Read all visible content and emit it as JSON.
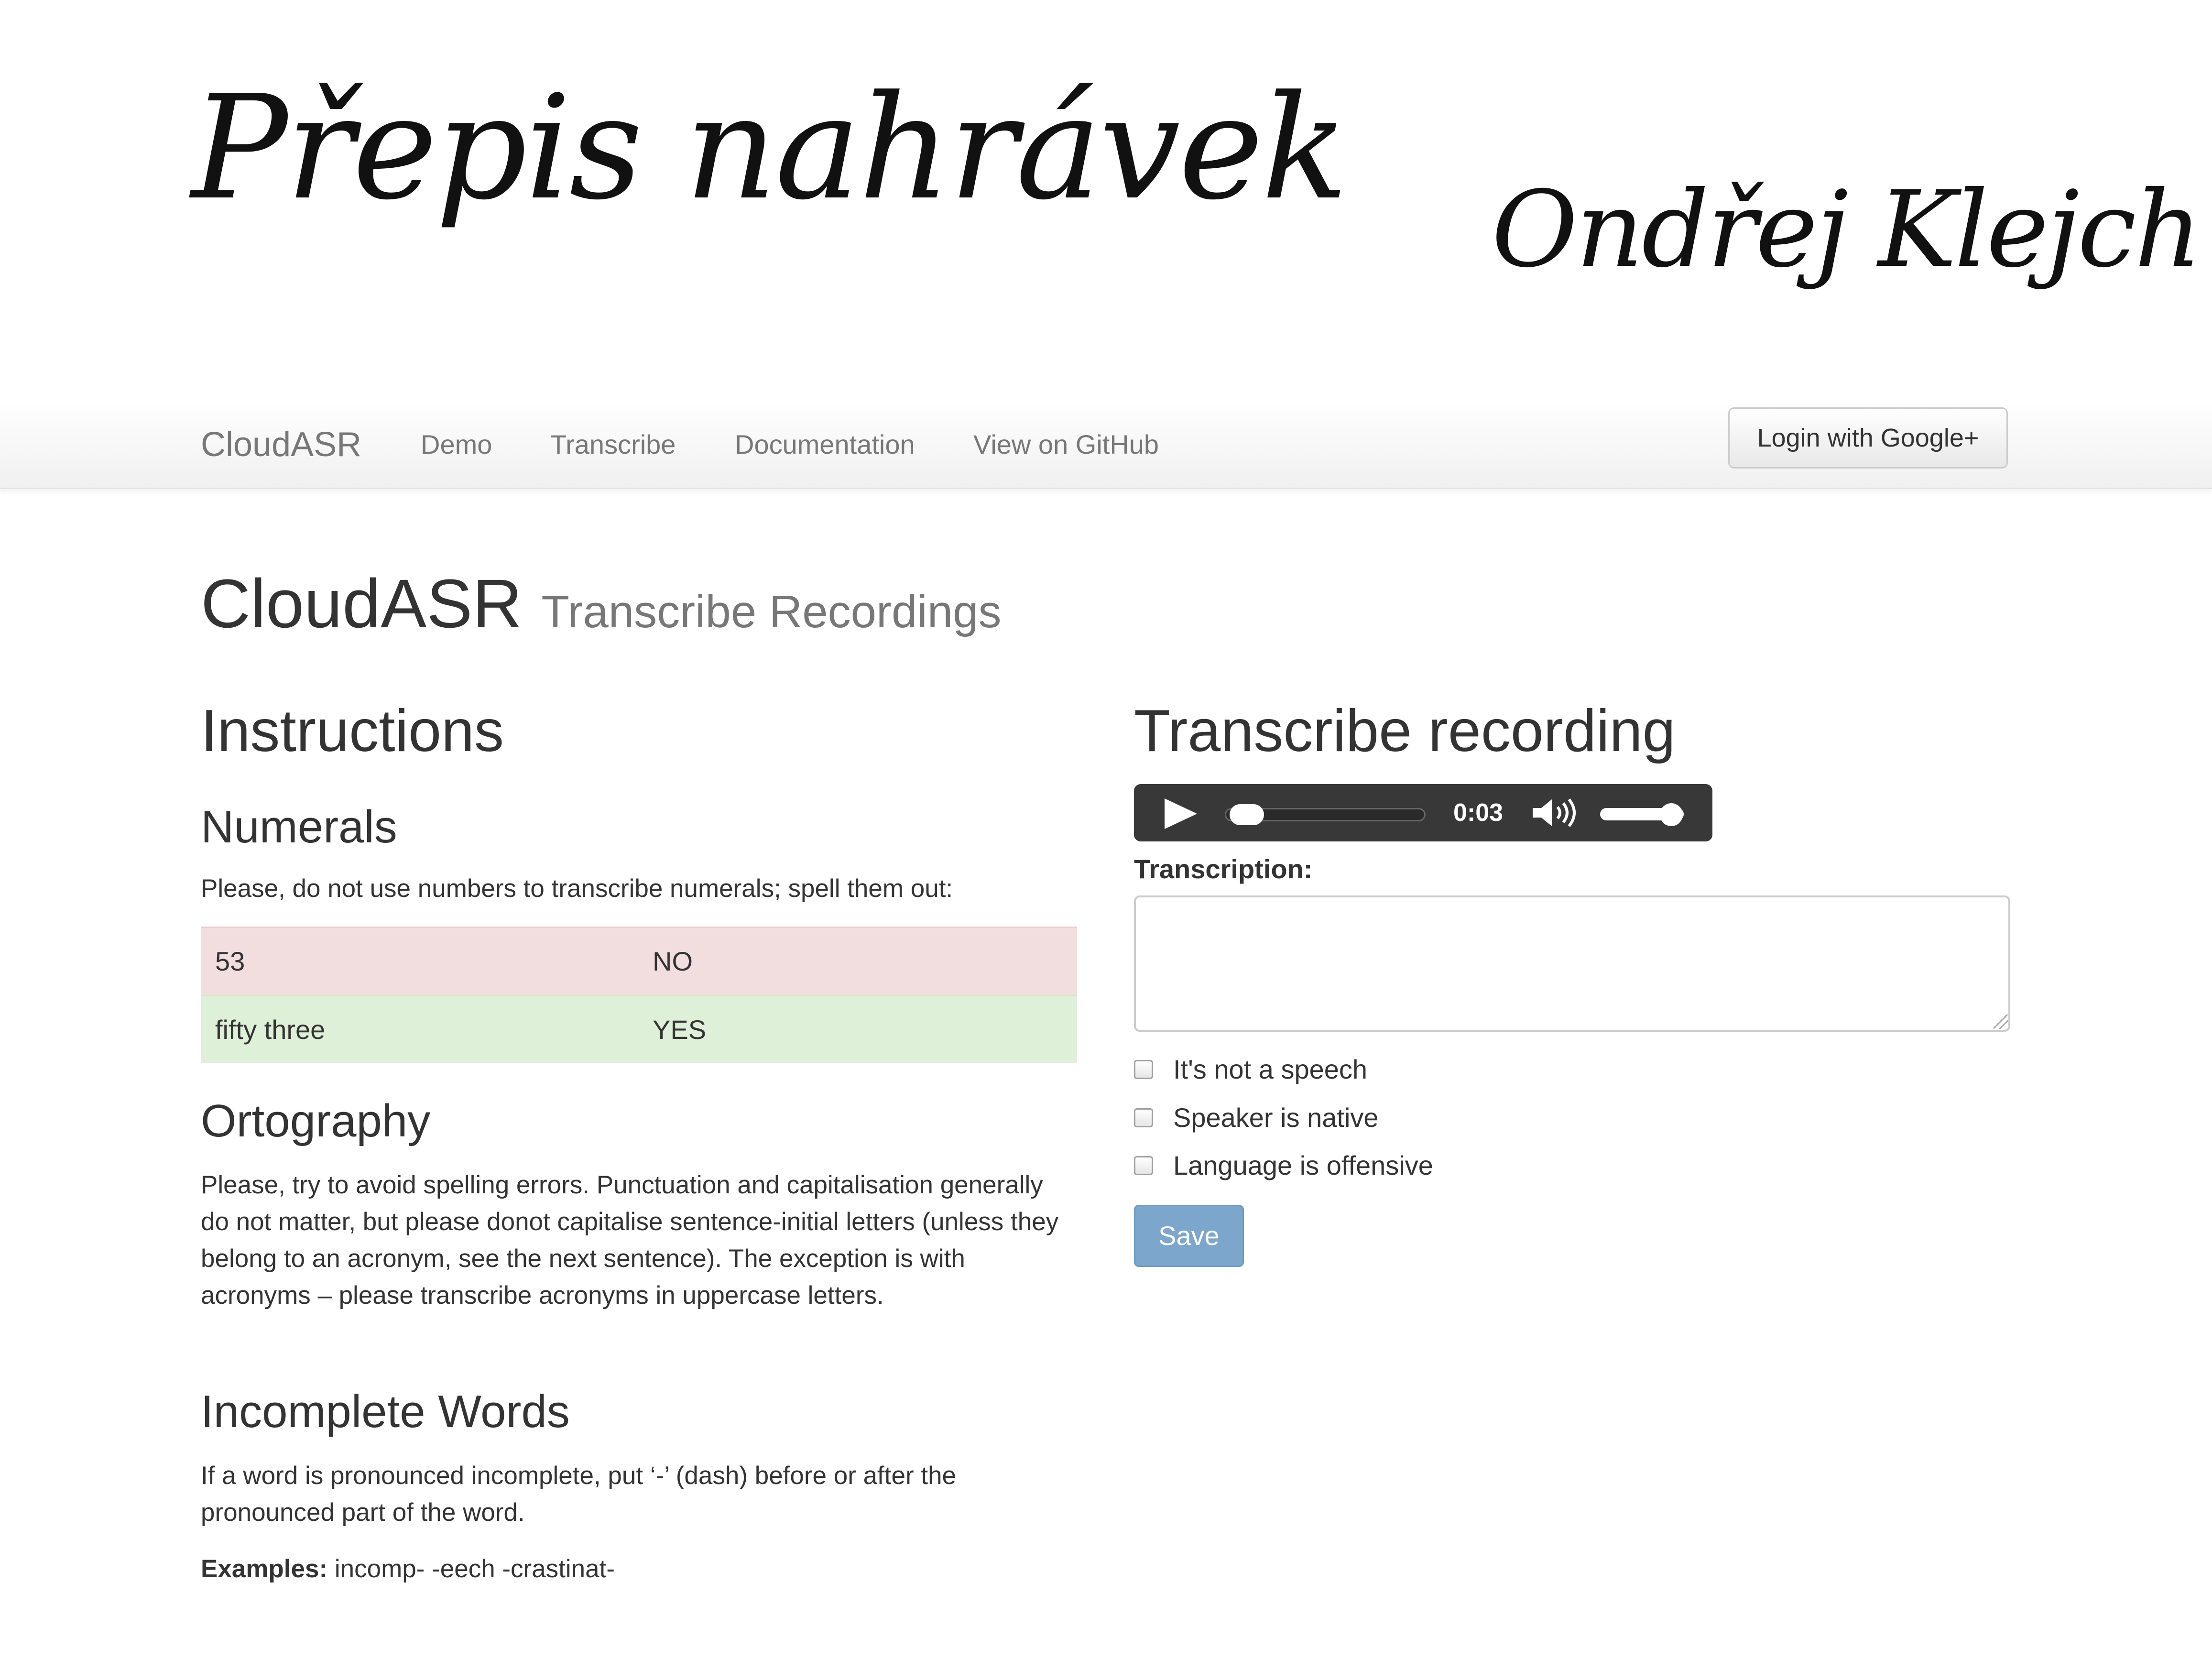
{
  "handwritten": {
    "title": "Přepis nahrávek",
    "author": "Ondřej Klejch"
  },
  "navbar": {
    "brand": "CloudASR",
    "links": [
      "Demo",
      "Transcribe",
      "Documentation",
      "View on GitHub"
    ],
    "login_label": "Login with Google+"
  },
  "header": {
    "title": "CloudASR",
    "subtitle": "Transcribe Recordings"
  },
  "instructions": {
    "heading": "Instructions",
    "numerals": {
      "heading": "Numerals",
      "text": "Please, do not use numbers to transcribe numerals; spell them out:",
      "rows": [
        {
          "example": "53",
          "verdict": "NO"
        },
        {
          "example": "fifty three",
          "verdict": "YES"
        }
      ]
    },
    "ortography": {
      "heading": "Ortography",
      "text": "Please, try to avoid spelling errors. Punctuation and capitalisation generally do not matter, but please donot capitalise sentence-initial letters (unless they belong to an acronym, see the next sentence). The exception is with acronyms – please transcribe acronyms in uppercase letters."
    },
    "incomplete": {
      "heading": "Incomplete Words",
      "text": "If a word is pronounced incomplete, put ‘-’ (dash) before or after the pronounced part of the word.",
      "examples_label": "Examples:",
      "examples": "incomp- -eech -crastinat-"
    }
  },
  "transcribe": {
    "heading": "Transcribe recording",
    "player": {
      "time": "0:03",
      "progress_fraction": 0.03,
      "volume_fraction": 0.85
    },
    "transcription_label": "Transcription:",
    "transcription_value": "",
    "checkboxes": [
      {
        "label": "It's not a speech",
        "checked": false
      },
      {
        "label": "Speaker is native",
        "checked": false
      },
      {
        "label": "Language is offensive",
        "checked": false
      }
    ],
    "save_label": "Save"
  },
  "colors": {
    "row_no_bg": "#f2dede",
    "row_yes_bg": "#dff0d8",
    "save_button": "#7da6cd",
    "player_bg": "#383838"
  },
  "icons": [
    "play-icon",
    "volume-icon"
  ]
}
